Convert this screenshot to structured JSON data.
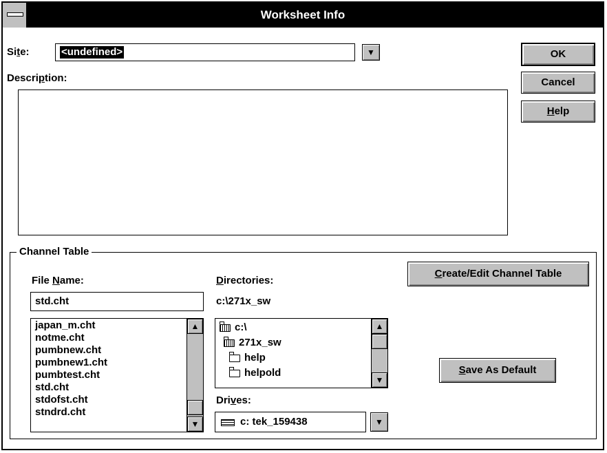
{
  "window": {
    "title": "Worksheet Info"
  },
  "site": {
    "label_pre": "Si",
    "label_accel": "t",
    "label_post": "e:",
    "value": "<undefined>"
  },
  "description": {
    "label_pre": "Descri",
    "label_accel": "p",
    "label_post": "tion:",
    "value": ""
  },
  "buttons": {
    "ok": "OK",
    "cancel": "Cancel",
    "help_accel": "H",
    "help_rest": "elp",
    "create_accel": "C",
    "create_rest": "reate/Edit Channel Table",
    "save_accel": "S",
    "save_rest": "ave As Default"
  },
  "channel_table": {
    "group_label": "Channel Table",
    "file_name_label_pre": "File ",
    "file_name_label_accel": "N",
    "file_name_label_post": "ame:",
    "file_name_value": "std.cht",
    "files": [
      "japan_m.cht",
      "notme.cht",
      "pumbnew.cht",
      "pumbnew1.cht",
      "pumbtest.cht",
      "std.cht",
      "stdofst.cht",
      "stndrd.cht"
    ],
    "directories_label_accel": "D",
    "directories_label_rest": "irectories:",
    "current_dir": "c:\\271x_sw",
    "dirs": [
      {
        "name": "c:\\",
        "icon": "open-folder-icon"
      },
      {
        "name": "271x_sw",
        "icon": "open-folder-icon"
      },
      {
        "name": "help",
        "icon": "folder-icon"
      },
      {
        "name": "helpold",
        "icon": "folder-icon"
      }
    ],
    "drives_label_pre": "Dri",
    "drives_label_accel": "v",
    "drives_label_post": "es:",
    "drive_value": "c: tek_159438"
  },
  "icons": {
    "scroll_up": "up-arrow-icon",
    "scroll_down": "down-arrow-icon",
    "dropdown": "dropdown-arrow-icon",
    "drive": "drive-icon"
  }
}
